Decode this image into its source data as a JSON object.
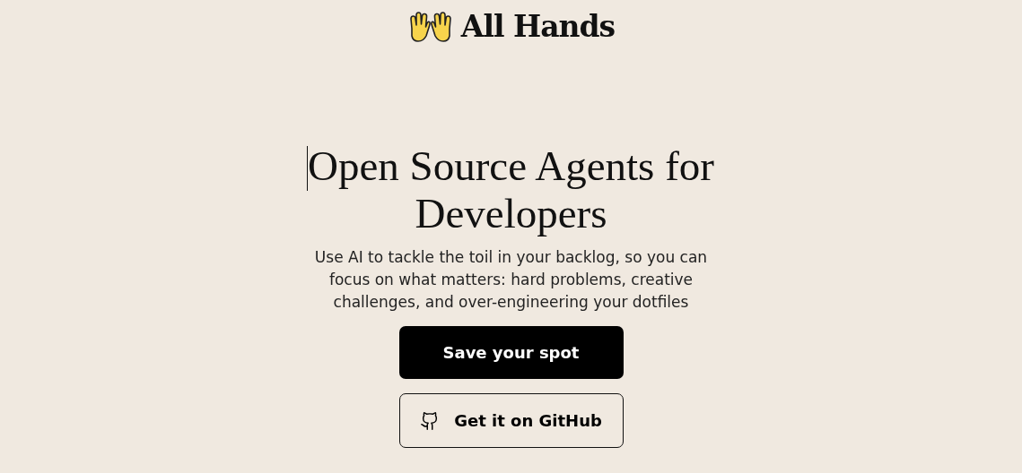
{
  "brand": {
    "name": "All Hands"
  },
  "hero": {
    "headline": [
      "Open Source Agents for",
      "Developers"
    ],
    "subtitle": "Use AI to tackle the toil in your backlog, so you can focus on what matters: hard problems, creative challenges, and over-engineering your dotfiles"
  },
  "buttons": [
    {
      "label": "Save your spot",
      "kind": "primary"
    },
    {
      "label": "Get it on GitHub",
      "kind": "github"
    }
  ]
}
